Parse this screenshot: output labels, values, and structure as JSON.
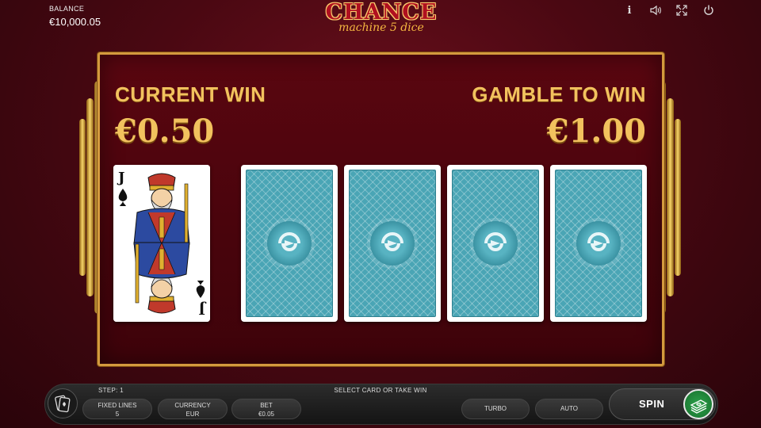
{
  "header": {
    "balance_label": "BALANCE",
    "balance_value": "€10,000.05",
    "logo_main": "CHANCE",
    "logo_sub": "machine 5 dice",
    "icons": [
      "info-icon",
      "sound-icon",
      "fullscreen-icon",
      "power-icon"
    ],
    "info_glyph": "i"
  },
  "gamble": {
    "current_win_label": "CURRENT WIN",
    "current_win_value": "€0.50",
    "gamble_label": "GAMBLE TO WIN",
    "gamble_value": "€1.00",
    "dealer_card": {
      "rank": "J",
      "suit": "♠",
      "face": "jack-of-spades"
    },
    "face_down_cards": 4
  },
  "footer": {
    "step": "STEP: 1",
    "instruction": "SELECT CARD OR TAKE WIN",
    "fixed_lines_label": "FIXED LINES",
    "fixed_lines_value": "5",
    "currency_label": "CURRENCY",
    "currency_value": "EUR",
    "bet_label": "BET",
    "bet_value": "€0.05",
    "turbo_label": "TURBO",
    "auto_label": "AUTO",
    "spin_label": "SPIN"
  },
  "colors": {
    "gold": "#f2c25e",
    "panel": "#48040c",
    "card_back": "#4aa5b5",
    "collect_green": "#2ca24a"
  }
}
